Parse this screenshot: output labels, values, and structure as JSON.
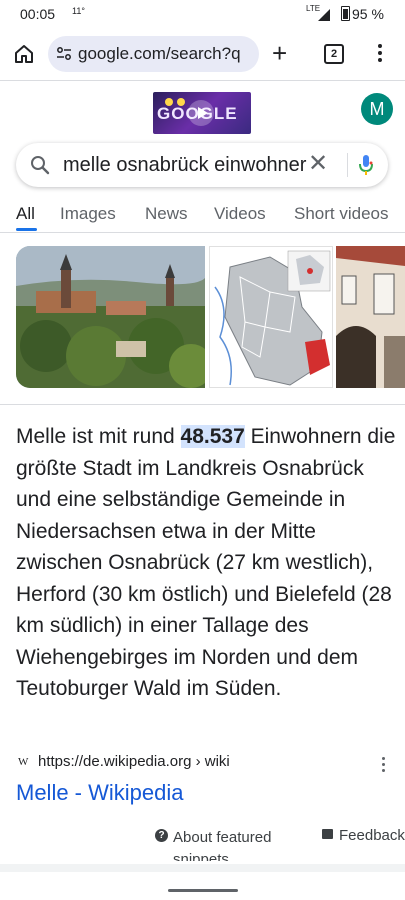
{
  "status_bar": {
    "time": "00:05",
    "temperature": "11°",
    "network": "LTE",
    "battery": "95 %"
  },
  "browser": {
    "url": "google.com/search?q",
    "tab_count": "2"
  },
  "google": {
    "doodle_text": "GOOGLE",
    "avatar_letter": "M",
    "search_query": "melle osnabrück einwohner",
    "tabs": [
      "All",
      "Images",
      "News",
      "Videos",
      "Short videos"
    ],
    "active_tab": "All"
  },
  "featured_snippet": {
    "text_before": "Melle ist mit rund ",
    "highlight": "48.537",
    "text_after": " Einwohnern die größte Stadt im Landkreis Osnabrück und eine selbständige Gemeinde in Niedersachsen etwa in der Mitte zwischen Osnabrück (27 km westlich), Herford (30 km östlich) und Bielefeld (28 km südlich) in einer Tallage des Wiehengebirges im Norden und dem Teutoburger Wald im Süden.",
    "source_favicon": "W",
    "source_url": "https://de.wikipedia.org › wiki",
    "link_title": "Melle - Wikipedia"
  },
  "footer": {
    "about": "About featured snippets",
    "feedback": "Feedback"
  },
  "colors": {
    "link": "#1558d6",
    "highlight": "#d3e3fd",
    "tab_underline": "#1a73e8",
    "avatar": "#00897b"
  }
}
